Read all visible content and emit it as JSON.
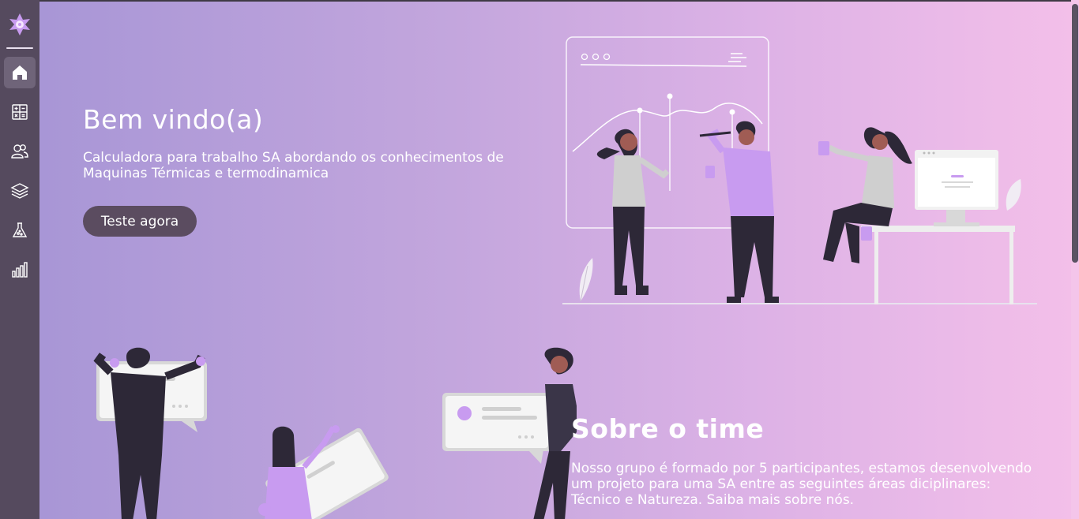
{
  "hero": {
    "title": "Bem vindo(a)",
    "description": "Calculadora para trabalho SA abordando os conhecimentos de Maquinas Térmicas e termodinamica",
    "cta_label": "Teste agora"
  },
  "about": {
    "title": "Sobre o time",
    "description": "Nosso grupo é formado por 5 participantes, estamos desenvolvendo um projeto para uma SA entre as seguintes áreas diciplinares: Técnico e Natureza. Saiba mais sobre nós."
  },
  "sidebar": {
    "items": [
      {
        "icon": "home-icon",
        "active": true
      },
      {
        "icon": "calculator-icon",
        "active": false
      },
      {
        "icon": "users-icon",
        "active": false
      },
      {
        "icon": "layers-icon",
        "active": false
      },
      {
        "icon": "flask-icon",
        "active": false
      },
      {
        "icon": "bar-chart-icon",
        "active": false
      }
    ]
  },
  "colors": {
    "sidebar": "#554a5e",
    "button": "#5b4c60",
    "accent": "#c89bf0",
    "gradient_start": "#a896d6",
    "gradient_end": "#f3bfe9"
  }
}
